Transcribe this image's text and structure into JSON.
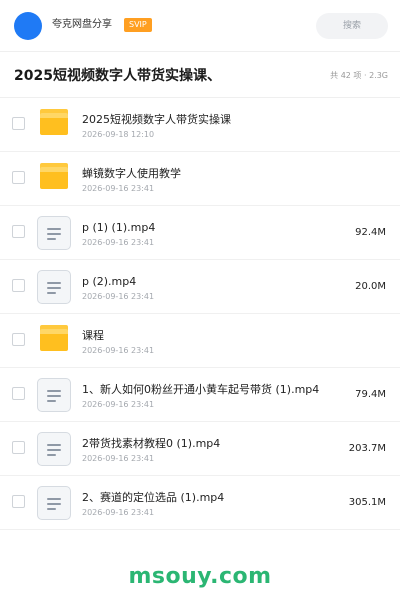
{
  "header": {
    "share_name": "夸克网盘分享",
    "badge": "SVIP",
    "search_label": "搜索",
    "avatar_color": "#1f7af5",
    "badge_color": "#ff9f21"
  },
  "title_bar": {
    "title": "2025短视频数字人带货实操课、",
    "summary": "共 42 项 · 2.3G"
  },
  "files": [
    {
      "type": "folder",
      "icon": "folder-icon",
      "name": "2025短视频数字人带货实操课",
      "date": "2026-09-18 12:10",
      "size": ""
    },
    {
      "type": "folder",
      "icon": "folder-icon",
      "name": "蝉镜数字人使用教学",
      "date": "2026-09-16 23:41",
      "size": ""
    },
    {
      "type": "file",
      "icon": "document-icon",
      "name": "p (1) (1).mp4",
      "date": "2026-09-16 23:41",
      "size": "92.4M"
    },
    {
      "type": "file",
      "icon": "document-icon",
      "name": "p (2).mp4",
      "date": "2026-09-16 23:41",
      "size": "20.0M"
    },
    {
      "type": "folder",
      "icon": "folder-icon",
      "name": "课程",
      "date": "2026-09-16 23:41",
      "size": ""
    },
    {
      "type": "file",
      "icon": "document-icon",
      "name": "1、新人如何0粉丝开通小黄车起号带货 (1).mp4",
      "date": "2026-09-16 23:41",
      "size": "79.4M"
    },
    {
      "type": "file",
      "icon": "document-icon",
      "name": "2带货找素材教程0 (1).mp4",
      "date": "2026-09-16 23:41",
      "size": "203.7M"
    },
    {
      "type": "file",
      "icon": "document-icon",
      "name": "2、赛道的定位选品 (1).mp4",
      "date": "2026-09-16 23:41",
      "size": "305.1M"
    }
  ],
  "watermark": {
    "text": "msouy.com",
    "color": "#2bb673"
  }
}
